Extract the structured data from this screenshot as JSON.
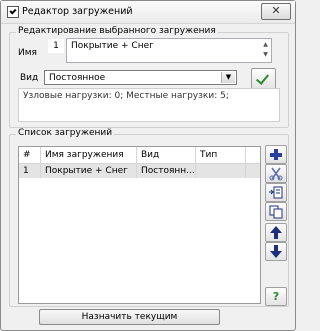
{
  "window": {
    "title": "Редактор загружений",
    "close_glyph": "✕"
  },
  "edit_group": {
    "title": "Редактирование выбранного загружения",
    "name_label": "Имя",
    "number": "1",
    "name_value": "Покрытие + Снег",
    "type_label": "Вид",
    "type_value": "Постоянное",
    "loads_info": "Узловые нагрузки: 0;  Местные нагрузки: 5;"
  },
  "list_group": {
    "title": "Список загружений",
    "columns": [
      "#",
      "Имя загружения",
      "Вид",
      "Тип"
    ],
    "rows": [
      {
        "num": "1",
        "name": "Покрытие + Снег",
        "kind": "Постоянн...",
        "type": ""
      }
    ]
  },
  "side_buttons": [
    "add-icon",
    "delete-icon",
    "insert-icon",
    "copy-icon",
    "move-up-icon",
    "move-down-icon",
    "help-icon"
  ],
  "help_glyph": "?",
  "assign_button": "Назначить текущим",
  "colors": {
    "add": "#2a3f9a",
    "delete": "#5a6db0",
    "arrows": "#1e2f7a",
    "help": "#2c8a2c",
    "check": "#2c8a2c"
  }
}
